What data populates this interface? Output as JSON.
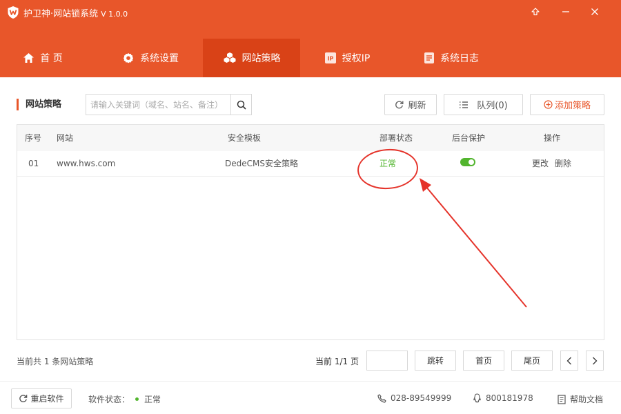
{
  "app": {
    "title": "护卫神·网站锁系统",
    "version": "V 1.0.0"
  },
  "tabs": [
    {
      "label": "首 页",
      "icon": "home-icon"
    },
    {
      "label": "系统设置",
      "icon": "gear-icon"
    },
    {
      "label": "网站策略",
      "icon": "cubes-icon",
      "active": true
    },
    {
      "label": "授权IP",
      "icon": "ip-icon"
    },
    {
      "label": "系统日志",
      "icon": "log-icon"
    }
  ],
  "toolbar": {
    "section_title": "网站策略",
    "search_placeholder": "请输入关键词（域名、站名、备注）",
    "refresh_label": "刷新",
    "queue_label": "队列(0)",
    "add_label": "添加策略"
  },
  "table": {
    "columns": [
      "序号",
      "网站",
      "安全模板",
      "部署状态",
      "后台保护",
      "操作"
    ],
    "rows": [
      {
        "index": "01",
        "site": "www.hws.com",
        "template": "DedeCMS安全策略",
        "status": "正常",
        "backend_protection": true,
        "edit_label": "更改",
        "delete_label": "删除"
      }
    ]
  },
  "pager": {
    "total_text": "当前共 1 条网站策略",
    "page_text": "当前 1/1 页",
    "jump_label": "跳转",
    "first_label": "首页",
    "last_label": "尾页"
  },
  "footer": {
    "restart_label": "重启软件",
    "status_label": "软件状态：",
    "status_value": "正常",
    "phone": "028-89549999",
    "qq": "800181978",
    "help_label": "帮助文档"
  },
  "colors": {
    "brand": "#e8562a",
    "tab_active": "#d94217",
    "ok_green": "#52b52e",
    "annotation_red": "#e5332a"
  }
}
